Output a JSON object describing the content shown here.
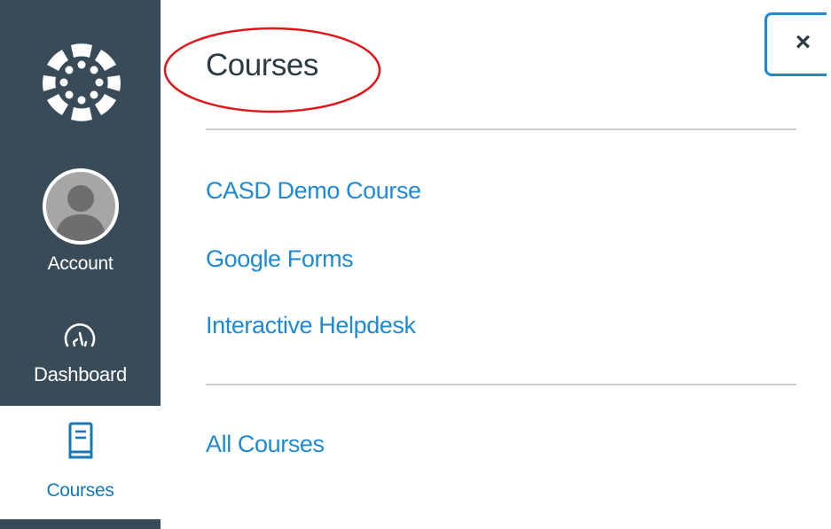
{
  "nav": {
    "account_label": "Account",
    "dashboard_label": "Dashboard",
    "courses_label": "Courses"
  },
  "tray": {
    "title": "Courses",
    "close_label": "×",
    "courses": [
      {
        "label": "CASD Demo Course"
      },
      {
        "label": "Google Forms"
      },
      {
        "label": "Interactive Helpdesk"
      }
    ],
    "all_courses_label": "All Courses"
  },
  "colors": {
    "nav_bg": "#394b58",
    "link": "#1d8ad2",
    "title": "#2d3b45",
    "annotation": "#e0161b"
  },
  "icons": [
    "canvas-logo-icon",
    "user-avatar-icon",
    "dashboard-gauge-icon",
    "courses-book-icon",
    "close-icon"
  ]
}
